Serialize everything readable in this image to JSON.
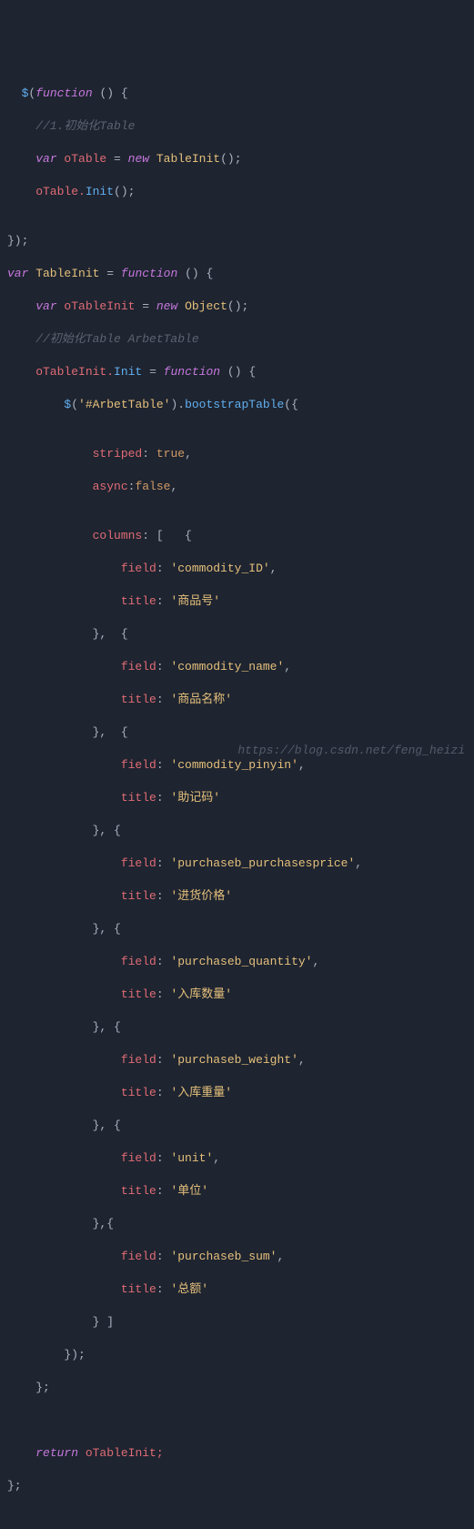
{
  "code": {
    "l1_a": "  ",
    "l1_dollar": "$",
    "l1_paren1": "(",
    "l1_func": "function",
    "l1_rest": " () {",
    "l2": "    //1.初始化Table",
    "l3_a": "    ",
    "l3_var": "var",
    "l3_name": " oTable ",
    "l3_eq": "=",
    "l3_new": " new",
    "l3_class": " TableInit",
    "l3_rest": "();",
    "l4_a": "    oTable.",
    "l4_method": "Init",
    "l4_rest": "();",
    "l5": "",
    "l6": "});",
    "l7_var": "var",
    "l7_name": " TableInit ",
    "l7_eq": "=",
    "l7_sp": " ",
    "l7_func": "function",
    "l7_rest": " () {",
    "l8_a": "    ",
    "l8_var": "var",
    "l8_name": " oTableInit ",
    "l8_eq": "=",
    "l8_new": " new",
    "l8_class": " Object",
    "l8_rest": "();",
    "l9": "    //初始化Table ArbetTable",
    "l10_a": "    oTableInit.",
    "l10_init": "Init",
    "l10_sp": " ",
    "l10_eq": "=",
    "l10_sp2": " ",
    "l10_func": "function",
    "l10_rest": " () {",
    "l11_a": "        ",
    "l11_dollar": "$",
    "l11_p1": "(",
    "l11_str": "'#ArbetTable'",
    "l11_p2": ").",
    "l11_boot": "bootstrapTable",
    "l11_rest": "({",
    "l12": "",
    "l13_a": "            ",
    "l13_prop": "striped",
    "l13_colon": ": ",
    "l13_val": "true",
    "l13_comma": ",",
    "l14_a": "            ",
    "l14_prop": "async",
    "l14_colon": ":",
    "l14_val": "false",
    "l14_comma": ",",
    "l15": "",
    "l16_a": "            ",
    "l16_prop": "columns",
    "l16_rest": ": [   {",
    "l17_a": "                ",
    "l17_prop": "field",
    "l17_colon": ": ",
    "l17_val": "'commodity_ID'",
    "l17_comma": ",",
    "l18_a": "                ",
    "l18_prop": "title",
    "l18_colon": ": ",
    "l18_val": "'商品号'",
    "l19": "            },  {",
    "l20_a": "                ",
    "l20_prop": "field",
    "l20_colon": ": ",
    "l20_val": "'commodity_name'",
    "l20_comma": ",",
    "l21_a": "                ",
    "l21_prop": "title",
    "l21_colon": ": ",
    "l21_val": "'商品名称'",
    "l22": "            },  {",
    "l23_a": "                ",
    "l23_prop": "field",
    "l23_colon": ": ",
    "l23_val": "'commodity_pinyin'",
    "l23_comma": ",",
    "l24_a": "                ",
    "l24_prop": "title",
    "l24_colon": ": ",
    "l24_val": "'助记码'",
    "l25": "            }, {",
    "l26_a": "                ",
    "l26_prop": "field",
    "l26_colon": ": ",
    "l26_val": "'purchaseb_purchasesprice'",
    "l26_comma": ",",
    "l27_a": "                ",
    "l27_prop": "title",
    "l27_colon": ": ",
    "l27_val": "'进货价格'",
    "l28": "            }, {",
    "l29_a": "                ",
    "l29_prop": "field",
    "l29_colon": ": ",
    "l29_val": "'purchaseb_quantity'",
    "l29_comma": ",",
    "l30_a": "                ",
    "l30_prop": "title",
    "l30_colon": ": ",
    "l30_val": "'入库数量'",
    "l31": "            }, {",
    "l32_a": "                ",
    "l32_prop": "field",
    "l32_colon": ": ",
    "l32_val": "'purchaseb_weight'",
    "l32_comma": ",",
    "l33_a": "                ",
    "l33_prop": "title",
    "l33_colon": ": ",
    "l33_val": "'入库重量'",
    "l34": "            }, {",
    "l35_a": "                ",
    "l35_prop": "field",
    "l35_colon": ": ",
    "l35_val": "'unit'",
    "l35_comma": ",",
    "l36_a": "                ",
    "l36_prop": "title",
    "l36_colon": ": ",
    "l36_val": "'单位'",
    "l37": "            },{",
    "l38_a": "                ",
    "l38_prop": "field",
    "l38_colon": ": ",
    "l38_val": "'purchaseb_sum'",
    "l38_comma": ",",
    "l39_a": "                ",
    "l39_prop": "title",
    "l39_colon": ": ",
    "l39_val": "'总额'",
    "l40": "            } ]",
    "l41": "        });",
    "l42": "    };",
    "l43": "",
    "l44": "",
    "l45_a": "    ",
    "l45_ret": "return",
    "l45_rest": " oTableInit;",
    "l46": "};"
  },
  "watermark": "https://blog.csdn.net/feng_heizi"
}
